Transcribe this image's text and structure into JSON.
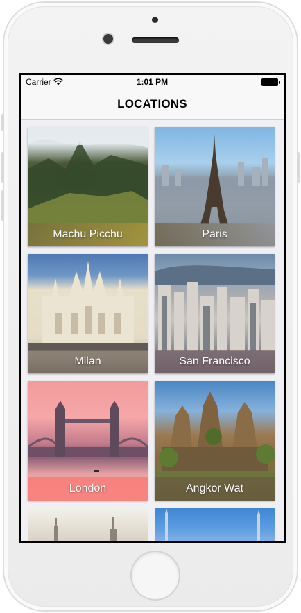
{
  "status_bar": {
    "carrier": "Carrier",
    "time": "1:01 PM"
  },
  "nav": {
    "title": "LOCATIONS"
  },
  "locations": [
    {
      "label": "Machu Picchu"
    },
    {
      "label": "Paris"
    },
    {
      "label": "Milan"
    },
    {
      "label": "San Francisco"
    },
    {
      "label": "London"
    },
    {
      "label": "Angkor Wat"
    },
    {
      "label": ""
    },
    {
      "label": ""
    }
  ],
  "icons": {
    "wifi": "wifi-icon",
    "battery": "battery-icon"
  },
  "colors": {
    "nav_background": "#f8f8f8",
    "grid_background": "#efeff4"
  }
}
